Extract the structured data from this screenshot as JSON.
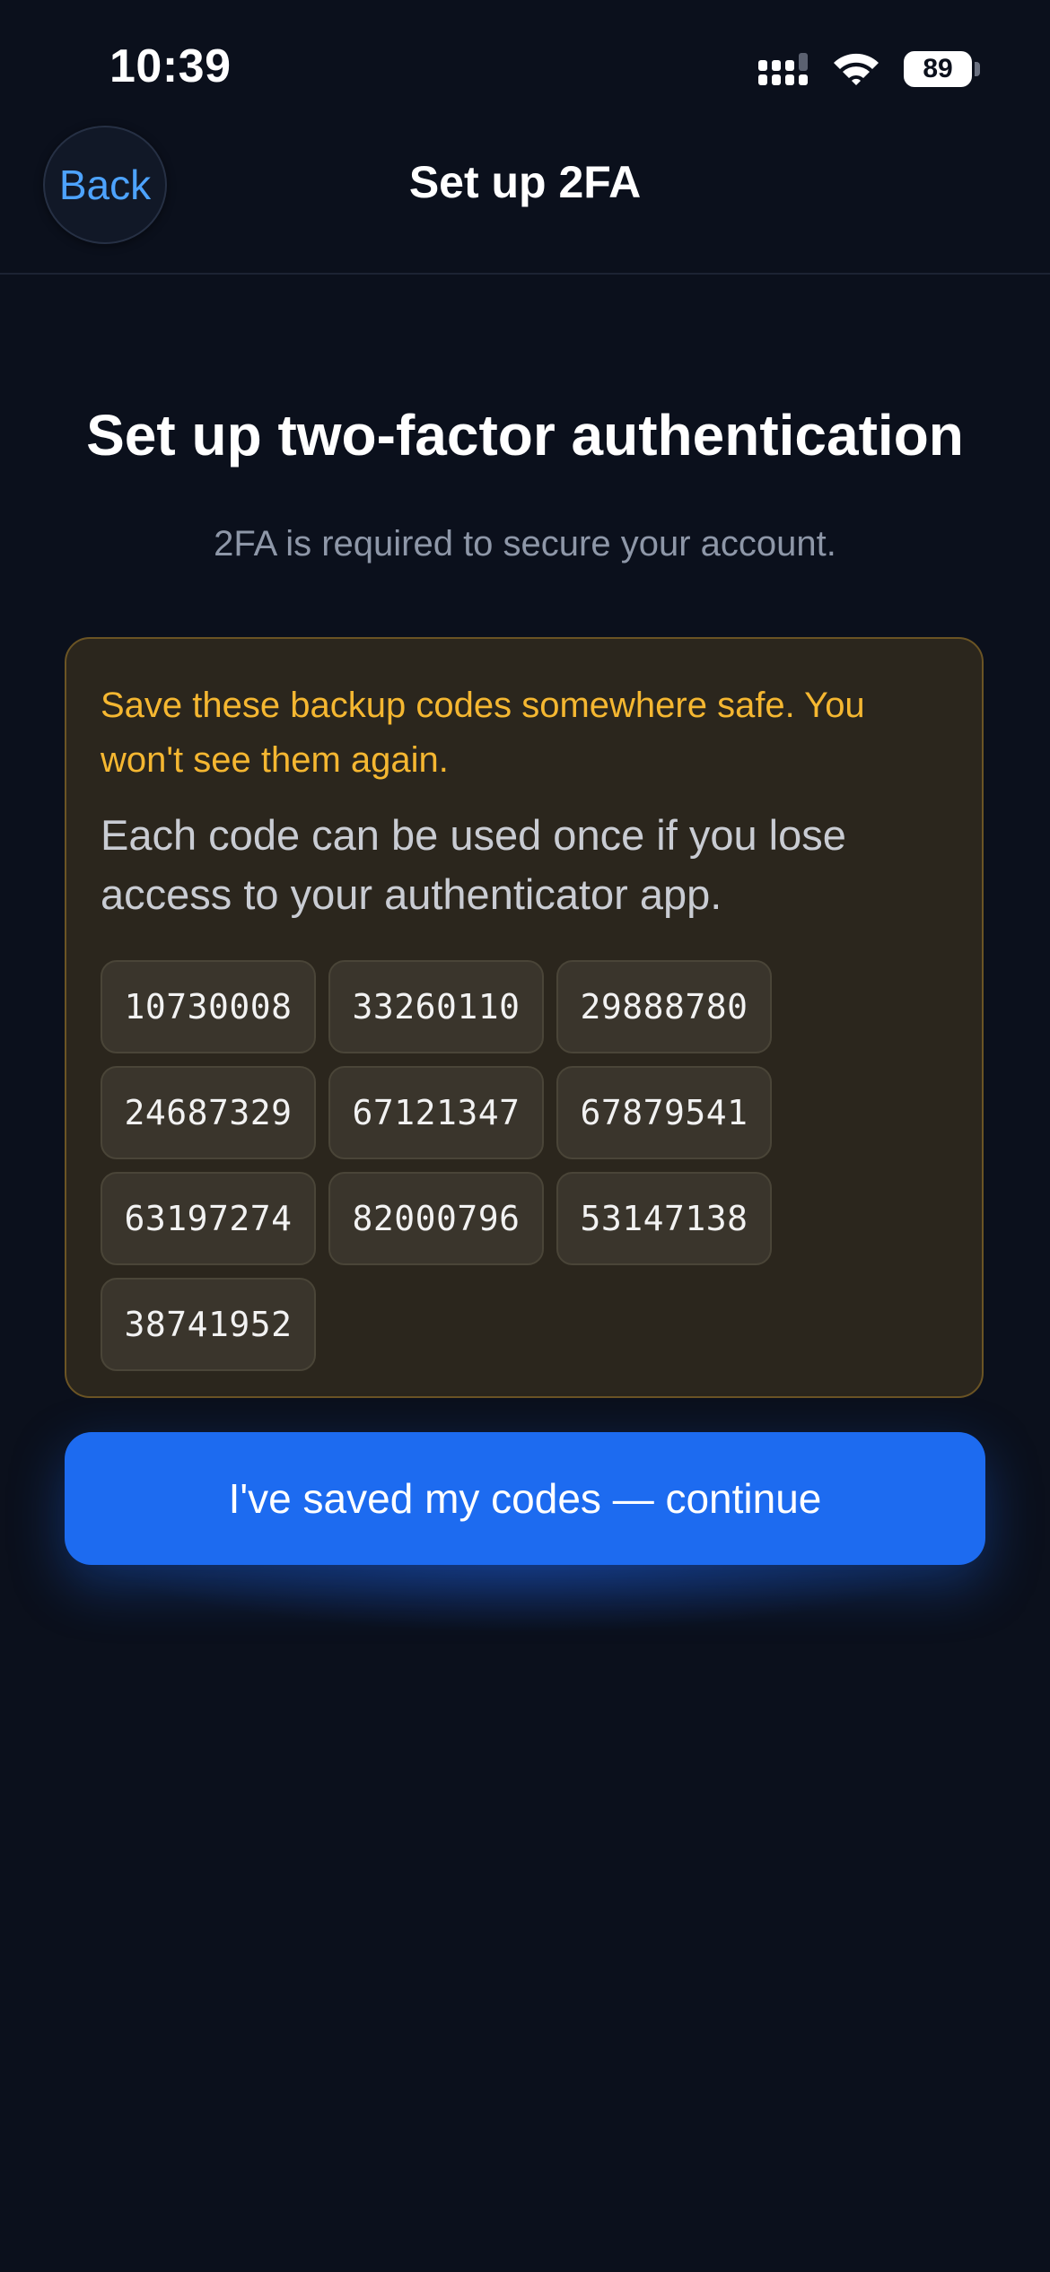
{
  "status_bar": {
    "time": "10:39",
    "battery_level": "89",
    "icons": [
      "signal-icon",
      "wifi-icon",
      "battery-icon"
    ]
  },
  "nav": {
    "back_label": "Back",
    "title": "Set up 2FA"
  },
  "main": {
    "title": "Set up two-factor authentication",
    "subtitle": "2FA is required to secure your account."
  },
  "backup_codes": {
    "warning": "Save these backup codes somewhere safe. You won't see them again.",
    "info": "Each code can be used once if you lose access to your authenticator app.",
    "codes": [
      "10730008",
      "33260110",
      "29888780",
      "24687329",
      "67121347",
      "67879541",
      "63197274",
      "82000796",
      "53147138",
      "38741952"
    ]
  },
  "continue_label": "I've saved my codes — continue",
  "colors": {
    "background": "#0b101c",
    "accent": "#1d6bf0",
    "link": "#4da3ff",
    "warning": "#f5b731",
    "card_bg": "#2b261d",
    "card_border": "#6b5424"
  }
}
